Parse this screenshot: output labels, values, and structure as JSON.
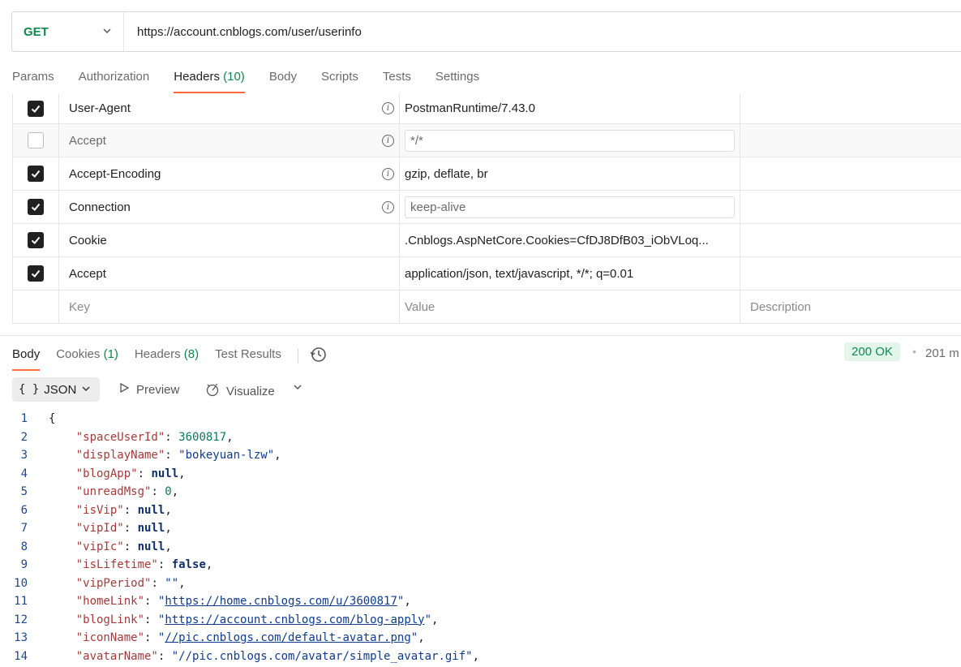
{
  "request": {
    "method": "GET",
    "url": "https://account.cnblogs.com/user/userinfo"
  },
  "request_tabs": [
    {
      "label": "Params"
    },
    {
      "label": "Authorization"
    },
    {
      "label": "Headers",
      "count": "(10)"
    },
    {
      "label": "Body"
    },
    {
      "label": "Scripts"
    },
    {
      "label": "Tests"
    },
    {
      "label": "Settings"
    }
  ],
  "headers": [
    {
      "checked": true,
      "key": "User-Agent",
      "value": "PostmanRuntime/7.43.0"
    },
    {
      "checked": false,
      "key": "Accept",
      "value": "*/*"
    },
    {
      "checked": true,
      "key": "Accept-Encoding",
      "value": "gzip, deflate, br"
    },
    {
      "checked": true,
      "key": "Connection",
      "value": "keep-alive"
    },
    {
      "checked": true,
      "key": "Cookie",
      "value": ".Cnblogs.AspNetCore.Cookies=CfDJ8DfB03_iObVLoq..."
    },
    {
      "checked": true,
      "key": "Accept",
      "value": "application/json, text/javascript, */*; q=0.01"
    }
  ],
  "new_row": {
    "key_placeholder": "Key",
    "value_placeholder": "Value",
    "desc_placeholder": "Description"
  },
  "response_tabs": [
    {
      "label": "Body"
    },
    {
      "label": "Cookies",
      "count": "(1)"
    },
    {
      "label": "Headers",
      "count": "(8)"
    },
    {
      "label": "Test Results"
    }
  ],
  "response": {
    "status": "200 OK",
    "time": "201 m"
  },
  "body_toolbar": {
    "format": "JSON",
    "braces": "{ }",
    "preview": "Preview",
    "visualize": "Visualize"
  },
  "code": {
    "line_numbers": [
      "1",
      "2",
      "3",
      "4",
      "5",
      "6",
      "7",
      "8",
      "9",
      "10",
      "11",
      "12",
      "13",
      "14"
    ],
    "open": "{",
    "lines": [
      {
        "key": "\"spaceUserId\"",
        "value": "3600817",
        "type": "n"
      },
      {
        "key": "\"displayName\"",
        "value": "\"bokeyuan-lzw\"",
        "type": "s"
      },
      {
        "key": "\"blogApp\"",
        "value": "null",
        "type": "b"
      },
      {
        "key": "\"unreadMsg\"",
        "value": "0",
        "type": "n"
      },
      {
        "key": "\"isVip\"",
        "value": "null",
        "type": "b"
      },
      {
        "key": "\"vipId\"",
        "value": "null",
        "type": "b"
      },
      {
        "key": "\"vipIc\"",
        "value": "null",
        "type": "b"
      },
      {
        "key": "\"isLifetime\"",
        "value": "false",
        "type": "b"
      },
      {
        "key": "\"vipPeriod\"",
        "value": "\"\"",
        "type": "s"
      },
      {
        "key": "\"homeLink\"",
        "value": "https://home.cnblogs.com/u/3600817",
        "type": "link"
      },
      {
        "key": "\"blogLink\"",
        "value": "https://account.cnblogs.com/blog-apply",
        "type": "link"
      },
      {
        "key": "\"iconName\"",
        "value": "//pic.cnblogs.com/default-avatar.png",
        "type": "link"
      },
      {
        "key": "\"avatarName\"",
        "value": "\"//pic.cnblogs.com/avatar/simple_avatar.gif\"",
        "type": "s"
      }
    ]
  },
  "colors": {
    "accent": "#ff6c37",
    "success": "#0b8a4b"
  }
}
